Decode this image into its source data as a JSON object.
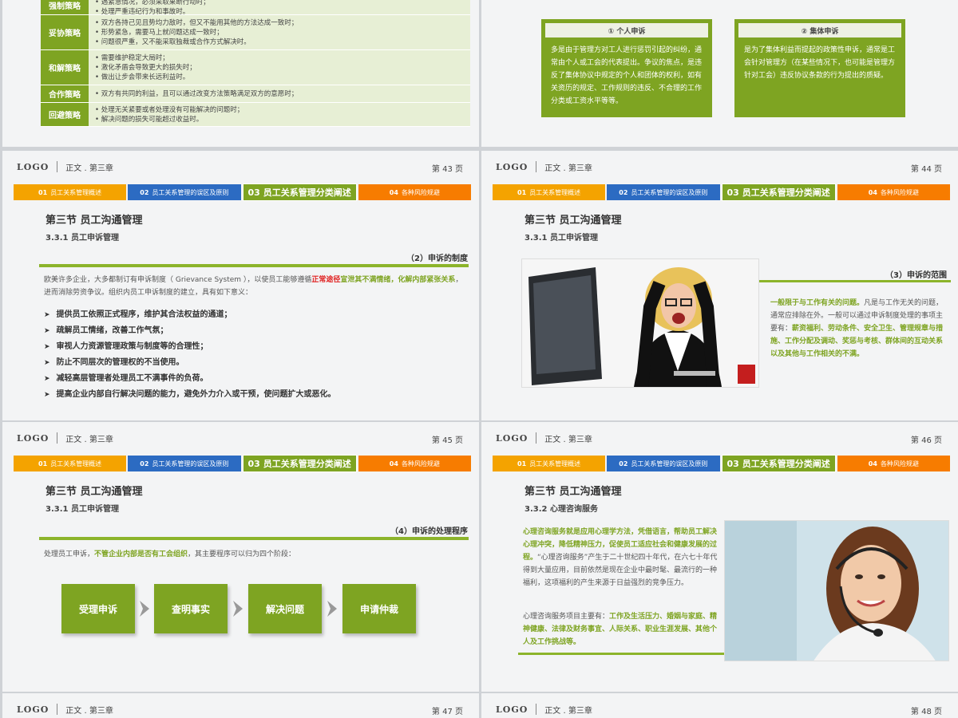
{
  "common": {
    "logo": "LOGO",
    "chapter": "正文 . 第三章",
    "tabs": [
      {
        "num": "01",
        "label": "员工关系管理概述"
      },
      {
        "num": "02",
        "label": "员工关系管理的误区及原则"
      },
      {
        "num": "03",
        "label": "员工关系管理分类阐述"
      },
      {
        "num": "04",
        "label": "各种风险规避"
      }
    ],
    "section": "第三节  员工沟通管理"
  },
  "slide42": {
    "rows": [
      {
        "label": "强制策略",
        "items": [
          "遇紧急情况，必须采取果断行动时；",
          "处理严重违纪行为和事故时。"
        ]
      },
      {
        "label": "妥协策略",
        "items": [
          "双方各持己见且势均力敌时，但又不能用其他的方法达成一致时；",
          "形势紧急，需要马上就问题达成一致时；",
          "问题很严重，又不能采取独裁或合作方式解决时。"
        ]
      },
      {
        "label": "和解策略",
        "items": [
          "需要维护稳定大局时；",
          "激化矛盾会导致更大的损失时；",
          "做出让步会带来长远利益时。"
        ]
      },
      {
        "label": "合作策略",
        "items": [
          "双方有共同的利益，且可以通过改变方法策略满足双方的意愿时；"
        ]
      },
      {
        "label": "回避策略",
        "items": [
          "处理无关紧要或者处理没有可能解决的问题时；",
          "解决问题的损失可能超过收益时。"
        ]
      }
    ]
  },
  "slide42b": {
    "card1": {
      "title": "① 个人申诉",
      "body": "多是由于管理方对工人进行惩罚引起的纠纷，通常由个人或工会的代表提出。争议的焦点，是违反了集体协议中规定的个人和团体的权利，如有关资历的规定、工作规则的违反、不合理的工作分类或工资水平等等。"
    },
    "card2": {
      "title": "② 集体申诉",
      "body": "是为了集体利益而提起的政策性申诉，通常是工会针对管理方（在某些情况下，也可能是管理方针对工会）违反协议条款的行为提出的质疑。"
    }
  },
  "slide43": {
    "page": "第 43 页",
    "subtitle": "3.3.1 员工申诉管理",
    "heading": "（2）申诉的制度",
    "intro_a": "欧美许多企业，大多都制订有申诉制度（ Grievance System ），以使员工能够遵循",
    "intro_red": "正常途径",
    "intro_g1": "宣泄其不满情绪，化解内部紧张关系",
    "intro_b": "，进而消除劳资争议。组织内员工申诉制度的建立，具有如下意义：",
    "points": [
      "提供员工依照正式程序，维护其合法权益的通道；",
      "疏解员工情绪，改善工作气氛；",
      "审视人力资源管理政策与制度等的合理性；",
      "防止不同层次的管理权的不当使用。",
      "减轻高层管理者处理员工不满事件的负荷。",
      "提高企业内部自行解决问题的能力，避免外力介入或干预，使问题扩大或恶化。"
    ]
  },
  "slide44": {
    "page": "第 44 页",
    "subtitle": "3.3.1 员工申诉管理",
    "heading": "（3）申诉的范围",
    "p_g1": "一般限于与工作有关的问题。",
    "p_a": "凡是与工作无关的问题，通常应排除在外。一般可以通过申诉制度处理的事项主要有：",
    "p_g2": "薪资福利、劳动条件、安全卫生、管理规章与措施、工作分配及调动、奖惩与考核、群体间的互动关系以及其他与工作相关的不满。"
  },
  "slide45": {
    "page": "第 45 页",
    "subtitle": "3.3.1 员工申诉管理",
    "heading": "（4）申诉的处理程序",
    "intro_a": "处理员工申诉，",
    "intro_g": "不管企业内部是否有工会组织",
    "intro_b": "，其主要程序可以归为四个阶段：",
    "steps": [
      "受理申诉",
      "查明事实",
      "解决问题",
      "申请仲裁"
    ]
  },
  "slide46": {
    "page": "第 46 页",
    "subtitle": "3.3.2 心理咨询服务",
    "p1_g": "心理咨询服务就是应用心理学方法，凭借语言，帮助员工解决心理冲突，降低精神压力，促使员工适应社会和健康发展的过程。",
    "p1_b": "“心理咨询服务”产生于二十世纪四十年代，在六七十年代得到大量应用，目前依然是现在企业中最时髦、最流行的一种福利，这项福利的产生来源于日益强烈的竞争压力。",
    "p2_a": "心理咨询服务项目主要有：",
    "p2_g": "工作及生活压力、婚姻与家庭、精神健康、法律及财务事宜、人际关系、职业生涯发展、其他个人及工作挑战等。"
  },
  "slide47": {
    "page": "第 47 页"
  },
  "slide48": {
    "page": "第 48 页"
  },
  "colors": {
    "green": "#7ea422",
    "orange": "#f4a300",
    "blue": "#2c6bc2",
    "deep_orange": "#f77c00"
  }
}
